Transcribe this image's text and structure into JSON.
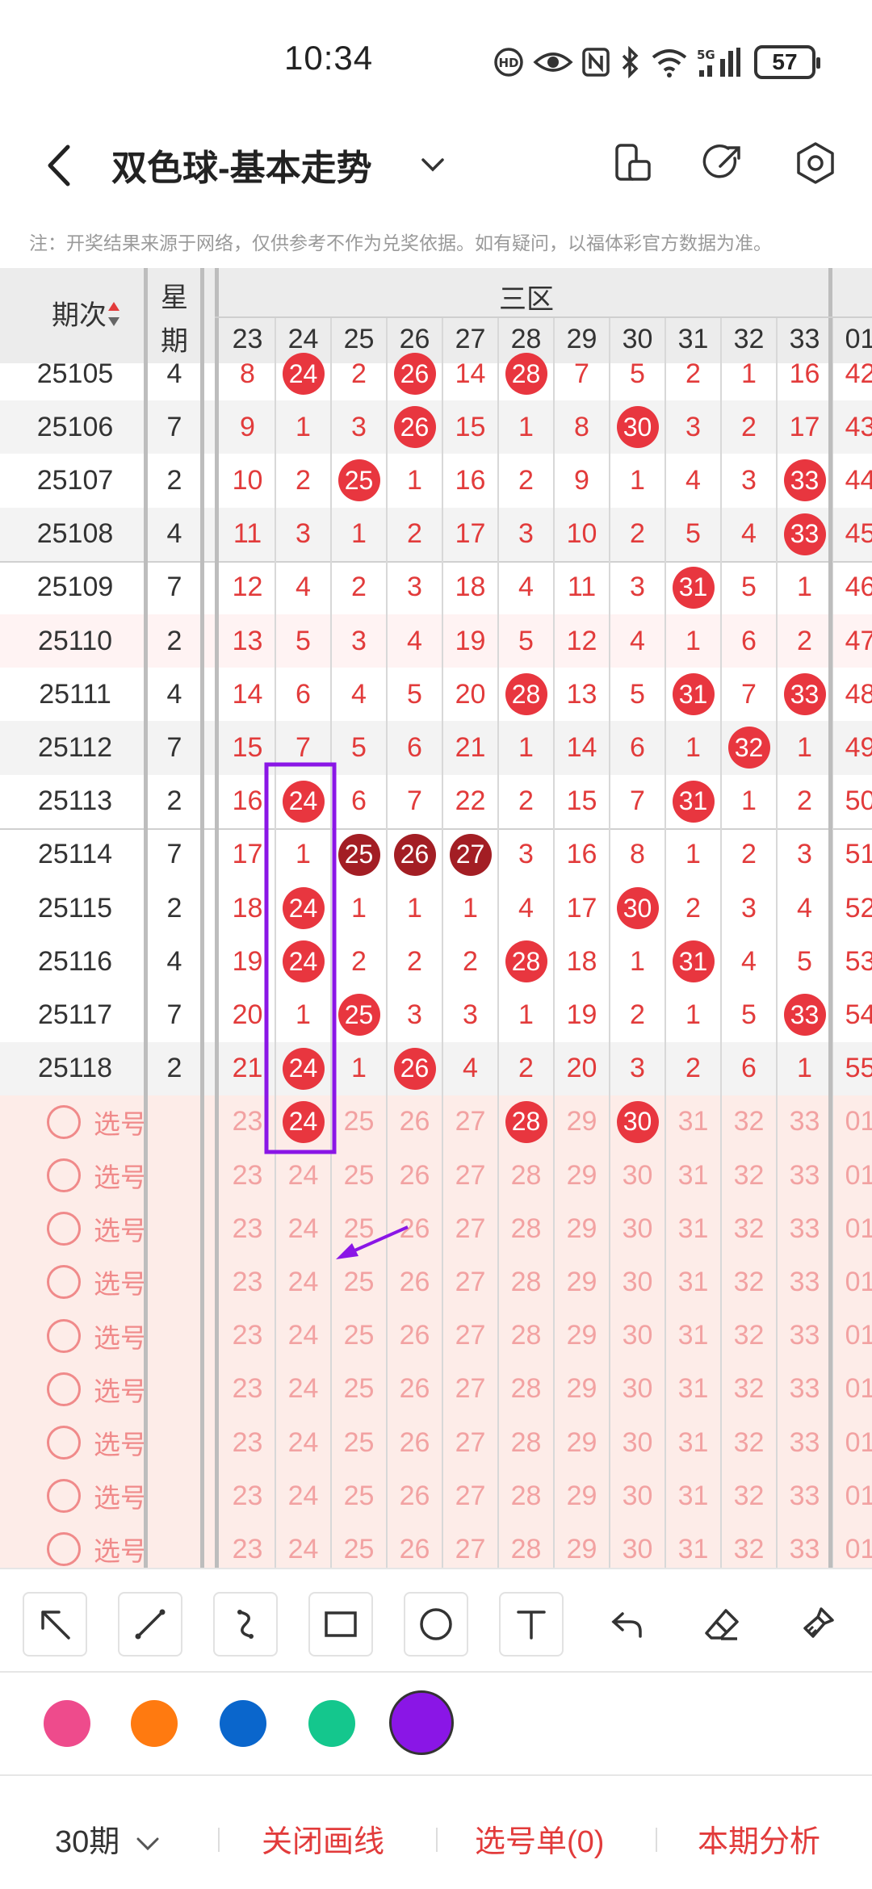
{
  "status_bar": {
    "time": "10:34",
    "battery": "57",
    "icons": [
      "hd-call-icon",
      "eye-icon",
      "nfc-icon",
      "bluetooth-icon",
      "wifi-icon",
      "5g-signal-icon",
      "battery-icon"
    ]
  },
  "header": {
    "title": "双色球-基本走势",
    "icons": [
      "back-icon",
      "chevron-down-icon",
      "screen-split-icon",
      "share-icon",
      "settings-icon"
    ]
  },
  "note": "注：开奖结果来源于网络，仅供参考不作为兑奖依据。如有疑问，以福体彩官方数据为准。",
  "table": {
    "header": {
      "issue_label": "期次",
      "weekday_label_1": "星",
      "weekday_label_2": "期",
      "zone_label": "三区",
      "columns": [
        "23",
        "24",
        "25",
        "26",
        "27",
        "28",
        "29",
        "30",
        "31",
        "32",
        "33",
        "01"
      ]
    },
    "rows": [
      {
        "issue": "25105",
        "weekday": "4",
        "cells": [
          "8",
          "24",
          "2",
          "26",
          "14",
          "28",
          "7",
          "5",
          "2",
          "1",
          "16",
          "42"
        ]
      },
      {
        "issue": "25106",
        "weekday": "7",
        "cells": [
          "9",
          "1",
          "3",
          "26",
          "15",
          "1",
          "8",
          "30",
          "3",
          "2",
          "17",
          "43"
        ]
      },
      {
        "issue": "25107",
        "weekday": "2",
        "cells": [
          "10",
          "2",
          "25",
          "1",
          "16",
          "2",
          "9",
          "1",
          "4",
          "3",
          "33",
          "44"
        ]
      },
      {
        "issue": "25108",
        "weekday": "4",
        "cells": [
          "11",
          "3",
          "1",
          "2",
          "17",
          "3",
          "10",
          "2",
          "5",
          "4",
          "33",
          "45"
        ]
      },
      {
        "issue": "25109",
        "weekday": "7",
        "cells": [
          "12",
          "4",
          "2",
          "3",
          "18",
          "4",
          "11",
          "3",
          "31",
          "5",
          "1",
          "46"
        ]
      },
      {
        "issue": "25110",
        "weekday": "2",
        "cells": [
          "13",
          "5",
          "3",
          "4",
          "19",
          "5",
          "12",
          "4",
          "1",
          "6",
          "2",
          "47"
        ]
      },
      {
        "issue": "25111",
        "weekday": "4",
        "cells": [
          "14",
          "6",
          "4",
          "5",
          "20",
          "28",
          "13",
          "5",
          "31",
          "7",
          "33",
          "48"
        ]
      },
      {
        "issue": "25112",
        "weekday": "7",
        "cells": [
          "15",
          "7",
          "5",
          "6",
          "21",
          "1",
          "14",
          "6",
          "1",
          "32",
          "1",
          "49"
        ]
      },
      {
        "issue": "25113",
        "weekday": "2",
        "cells": [
          "16",
          "24",
          "6",
          "7",
          "22",
          "2",
          "15",
          "7",
          "31",
          "1",
          "2",
          "50"
        ]
      },
      {
        "issue": "25114",
        "weekday": "7",
        "cells": [
          "17",
          "1",
          "25",
          "26",
          "27",
          "3",
          "16",
          "8",
          "1",
          "2",
          "3",
          "51"
        ]
      },
      {
        "issue": "25115",
        "weekday": "2",
        "cells": [
          "18",
          "24",
          "1",
          "1",
          "1",
          "4",
          "17",
          "30",
          "2",
          "3",
          "4",
          "52"
        ]
      },
      {
        "issue": "25116",
        "weekday": "4",
        "cells": [
          "19",
          "24",
          "2",
          "2",
          "2",
          "28",
          "18",
          "1",
          "31",
          "4",
          "5",
          "53"
        ]
      },
      {
        "issue": "25117",
        "weekday": "7",
        "cells": [
          "20",
          "1",
          "25",
          "3",
          "3",
          "1",
          "19",
          "2",
          "1",
          "5",
          "33",
          "54"
        ]
      },
      {
        "issue": "25118",
        "weekday": "2",
        "cells": [
          "21",
          "24",
          "1",
          "26",
          "4",
          "2",
          "20",
          "3",
          "2",
          "6",
          "1",
          "55"
        ]
      }
    ],
    "pick_label": "选号",
    "pick_values": [
      "23",
      "24",
      "25",
      "26",
      "27",
      "28",
      "29",
      "30",
      "31",
      "32",
      "33",
      "01"
    ],
    "pick_first_row_selected": [
      "24",
      "28",
      "30"
    ]
  },
  "toolbar": {
    "tools": [
      "arrow-tool-icon",
      "line-tool-icon",
      "curve-tool-icon",
      "rectangle-tool-icon",
      "circle-tool-icon",
      "text-tool-icon",
      "undo-icon",
      "eraser-icon",
      "clear-icon"
    ]
  },
  "palette": {
    "colors": [
      "#ee4b8c",
      "#ff7a10",
      "#0a66cc",
      "#14c78d",
      "#8a16e6"
    ],
    "selected": "#8a16e6"
  },
  "bottom_bar": {
    "period": "30期",
    "close_drawing": "关闭画线",
    "pick_list": "选号单(0)",
    "analysis": "本期分析"
  },
  "accent_color": "#e23b3b",
  "annotation_color": "#8a16e6"
}
